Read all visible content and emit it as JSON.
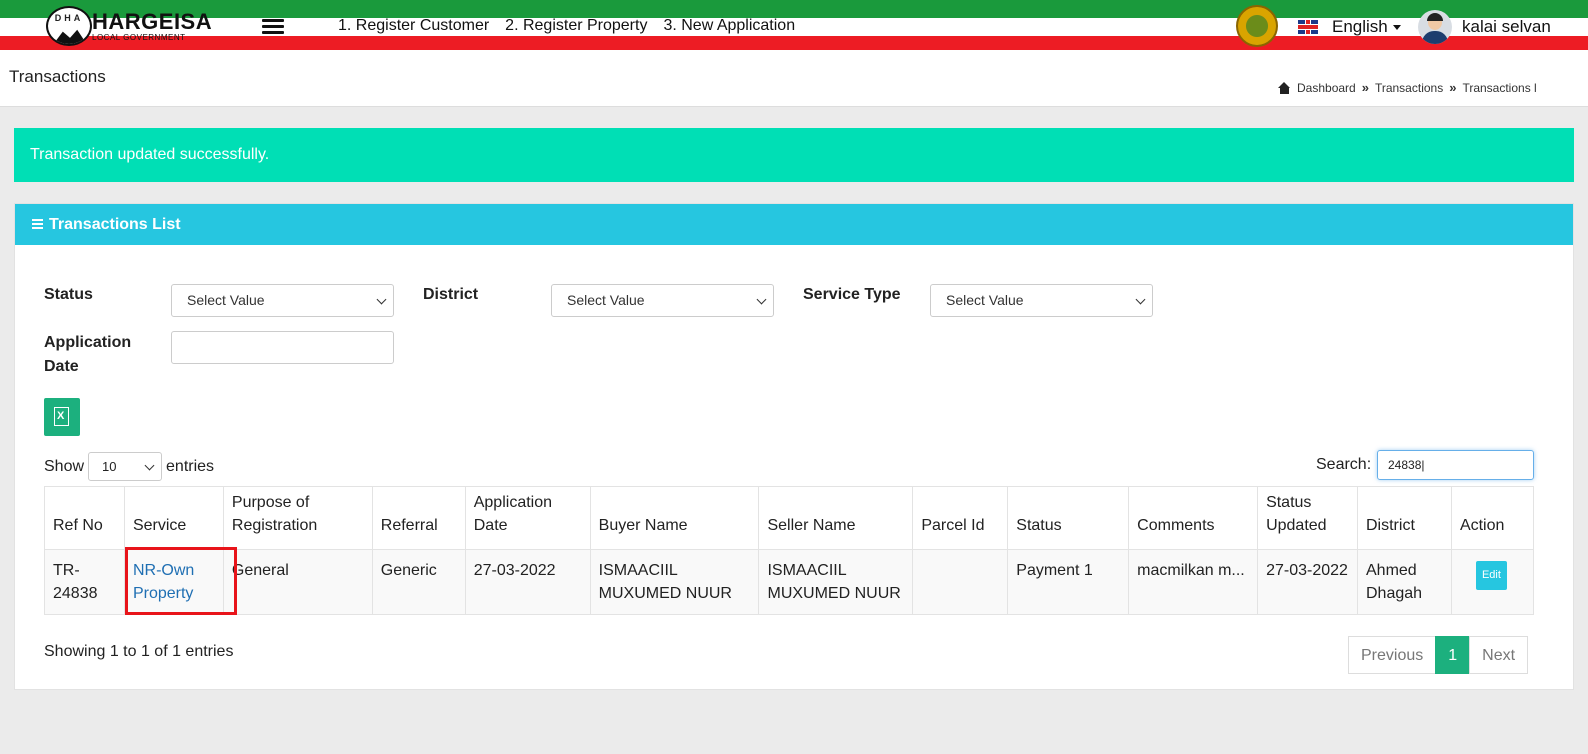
{
  "app": {
    "logo_text": "HARGEISA",
    "logo_subtext": "LOCAL GOVERNMENT",
    "logo_letters": "DHA",
    "nav": [
      "1. Register Customer",
      "2. Register Property",
      "3. New Application"
    ],
    "language": "English",
    "user_name": "kalai selvan",
    "colors": {
      "flag_green": "#1a9a3c",
      "flag_red": "#ed1c24",
      "accent_teal": "#26c6e0",
      "success": "#00dfb5",
      "excel": "#1cb07e"
    }
  },
  "page": {
    "title": "Transactions",
    "breadcrumb": [
      "Dashboard",
      "Transactions",
      "Transactions l"
    ],
    "breadcrumb_sep": "»"
  },
  "alert": {
    "message": "Transaction updated successfully."
  },
  "card": {
    "title": "Transactions List",
    "filters": {
      "status_label": "Status",
      "status_value": "Select Value",
      "district_label": "District",
      "district_value": "Select Value",
      "service_type_label": "Service Type",
      "service_type_value": "Select Value",
      "app_date_label_1": "Application",
      "app_date_label_2": "Date",
      "app_date_value": ""
    },
    "length": {
      "show": "Show",
      "value": "10",
      "entries": "entries"
    },
    "search": {
      "label": "Search:",
      "value": "24838|"
    },
    "table": {
      "headers": [
        [
          "",
          "Ref No"
        ],
        [
          "",
          "Service"
        ],
        [
          "Purpose of",
          "Registration"
        ],
        [
          "",
          "Referral"
        ],
        [
          "Application",
          "Date"
        ],
        [
          "",
          "Buyer Name"
        ],
        [
          "",
          "Seller Name"
        ],
        [
          "",
          "Parcel Id"
        ],
        [
          "",
          "Status"
        ],
        [
          "",
          "Comments"
        ],
        [
          "Status",
          "Updated"
        ],
        [
          "",
          "District"
        ],
        [
          "",
          "Action"
        ]
      ],
      "row": {
        "ref_no_1": "TR-",
        "ref_no_2": "24838",
        "service_1": "NR-Own",
        "service_2": "Property",
        "purpose": "General",
        "referral": "Generic",
        "app_date": "27-03-2022",
        "buyer_1": "ISMAACIIL",
        "buyer_2": "MUXUMED NUUR",
        "seller_1": "ISMAACIIL",
        "seller_2": "MUXUMED NUUR",
        "parcel_id": "",
        "status": "Payment 1",
        "comments": "macmilkan m...",
        "status_updated": "27-03-2022",
        "district_1": "Ahmed",
        "district_2": "Dhagah",
        "action": "Edit"
      }
    },
    "info": "Showing 1 to 1 of 1 entries",
    "pager": {
      "prev": "Previous",
      "page": "1",
      "next": "Next"
    }
  }
}
